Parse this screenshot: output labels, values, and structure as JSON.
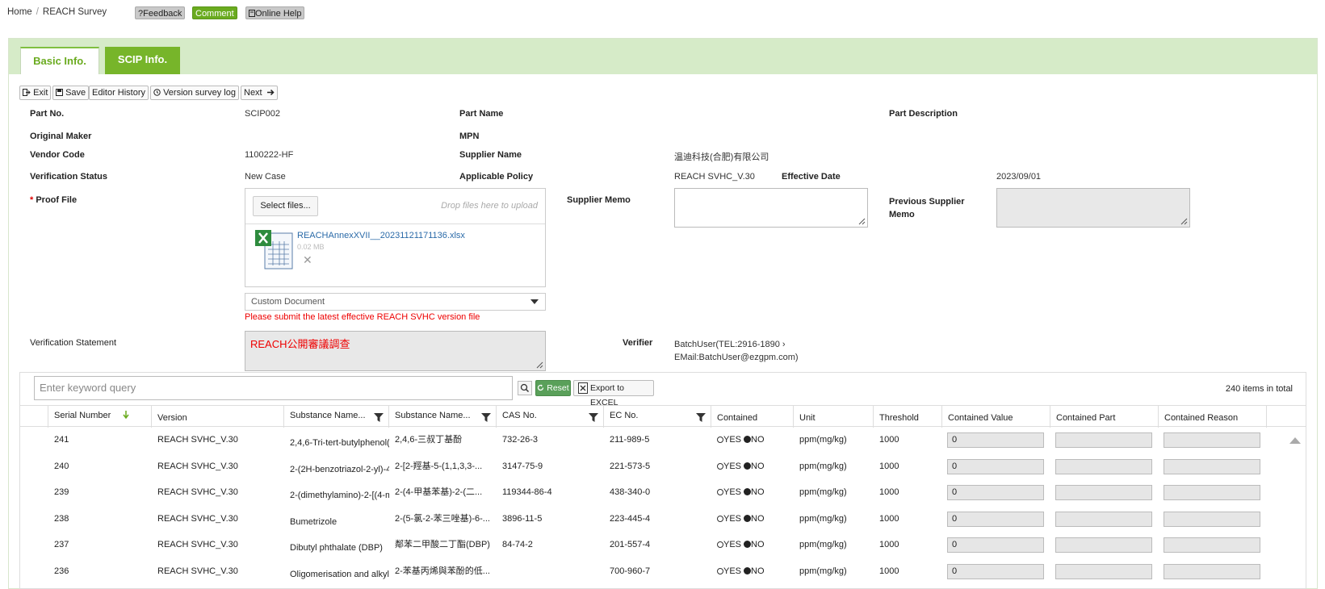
{
  "breadcrumb": {
    "home": "Home",
    "sep": "/",
    "current": "REACH Survey"
  },
  "top_buttons": {
    "feedback": "?Feedback",
    "comment": "Comment",
    "help": "Online Help"
  },
  "tabs": {
    "basic": "Basic Info.",
    "scip": "SCIP Info."
  },
  "actions": {
    "exit": "Exit",
    "save": "Save",
    "history": "Editor History",
    "version_log": "Version survey log",
    "next": "Next"
  },
  "form": {
    "part_no_label": "Part No.",
    "part_no": "SCIP002",
    "part_name_label": "Part Name",
    "part_desc_label": "Part Description",
    "original_maker_label": "Original Maker",
    "mpn_label": "MPN",
    "vendor_code_label": "Vendor Code",
    "vendor_code": "1100222-HF",
    "supplier_name_label": "Supplier Name",
    "supplier_name": "温迪科技(合肥)有限公司",
    "verification_status_label": "Verification Status",
    "verification_status": "New Case",
    "applicable_policy_label": "Applicable Policy",
    "applicable_policy": "REACH SVHC_V.30",
    "effective_date_label": "Effective Date",
    "effective_date": "2023/09/01",
    "proof_required": "*",
    "proof_file_label": "Proof File",
    "supplier_memo_label": "Supplier Memo",
    "previous_memo_label_1": "Previous Supplier",
    "previous_memo_label_2": "Memo",
    "select_files": "Select files...",
    "drop_hint": "Drop files here to upload",
    "file_name": "REACHAnnexXVII__20231121171136.xlsx",
    "file_size": "0.02 MB",
    "file_remove": "✕",
    "custom_doc": "Custom Document",
    "warning": "Please submit the latest effective REACH SVHC version file",
    "statement_label": "Verification Statement",
    "statement": "REACH公開審議調查",
    "verifier_label": "Verifier",
    "verifier_line1": "BatchUser(TEL:2916-1890 ›",
    "verifier_line2": "EMail:BatchUser@ezgpm.com)"
  },
  "grid": {
    "search_placeholder": "Enter keyword query",
    "reset": "Reset",
    "export": "Export to EXCEL",
    "total": "240 items in total",
    "headers": {
      "serial": "Serial Number",
      "version": "Version",
      "subname1": "Substance Name...",
      "subname2": "Substance Name...",
      "cas": "CAS No.",
      "ec": "EC No.",
      "contained": "Contained",
      "unit": "Unit",
      "threshold": "Threshold",
      "cvalue": "Contained Value",
      "cpart": "Contained Part",
      "creason": "Contained Reason"
    },
    "rows": [
      {
        "serial": "241",
        "version": "REACH SVHC_V.30",
        "name_en": "2,4,6-Tri-tert-butylphenol(2",
        "name_zh": "2,4,6-三叔丁基酚",
        "cas": "732-26-3",
        "ec": "211-989-5",
        "yes": "YES",
        "no": "NO",
        "unit": "ppm(mg/kg)",
        "threshold": "1000",
        "value": "0"
      },
      {
        "serial": "240",
        "version": "REACH SVHC_V.30",
        "name_en": "2-(2H-benzotriazol-2-yl)-4-",
        "name_zh": "2-[2-羥基-5-(1,1,3,3-...",
        "cas": "3147-75-9",
        "ec": "221-573-5",
        "yes": "YES",
        "no": "NO",
        "unit": "ppm(mg/kg)",
        "threshold": "1000",
        "value": "0"
      },
      {
        "serial": "239",
        "version": "REACH SVHC_V.30",
        "name_en": "2-(dimethylamino)-2-[(4-m",
        "name_zh": "2-(4-甲基苯基)-2-(二...",
        "cas": "119344-86-4",
        "ec": "438-340-0",
        "yes": "YES",
        "no": "NO",
        "unit": "ppm(mg/kg)",
        "threshold": "1000",
        "value": "0"
      },
      {
        "serial": "238",
        "version": "REACH SVHC_V.30",
        "name_en": "Bumetrizole",
        "name_zh": "2-(5-氯-2-苯三唑基)-6-...",
        "cas": "3896-11-5",
        "ec": "223-445-4",
        "yes": "YES",
        "no": "NO",
        "unit": "ppm(mg/kg)",
        "threshold": "1000",
        "value": "0"
      },
      {
        "serial": "237",
        "version": "REACH SVHC_V.30",
        "name_en": "Dibutyl phthalate (DBP)",
        "name_zh": "鄰苯二甲酸二丁酯(DBP)",
        "cas": "84-74-2",
        "ec": "201-557-4",
        "yes": "YES",
        "no": "NO",
        "unit": "ppm(mg/kg)",
        "threshold": "1000",
        "value": "0"
      },
      {
        "serial": "236",
        "version": "REACH SVHC_V.30",
        "name_en": "Oligomerisation and alkyla",
        "name_zh": "2-苯基丙烯與苯酚的低...",
        "cas": "",
        "ec": "700-960-7",
        "yes": "YES",
        "no": "NO",
        "unit": "ppm(mg/kg)",
        "threshold": "1000",
        "value": "0"
      }
    ]
  }
}
